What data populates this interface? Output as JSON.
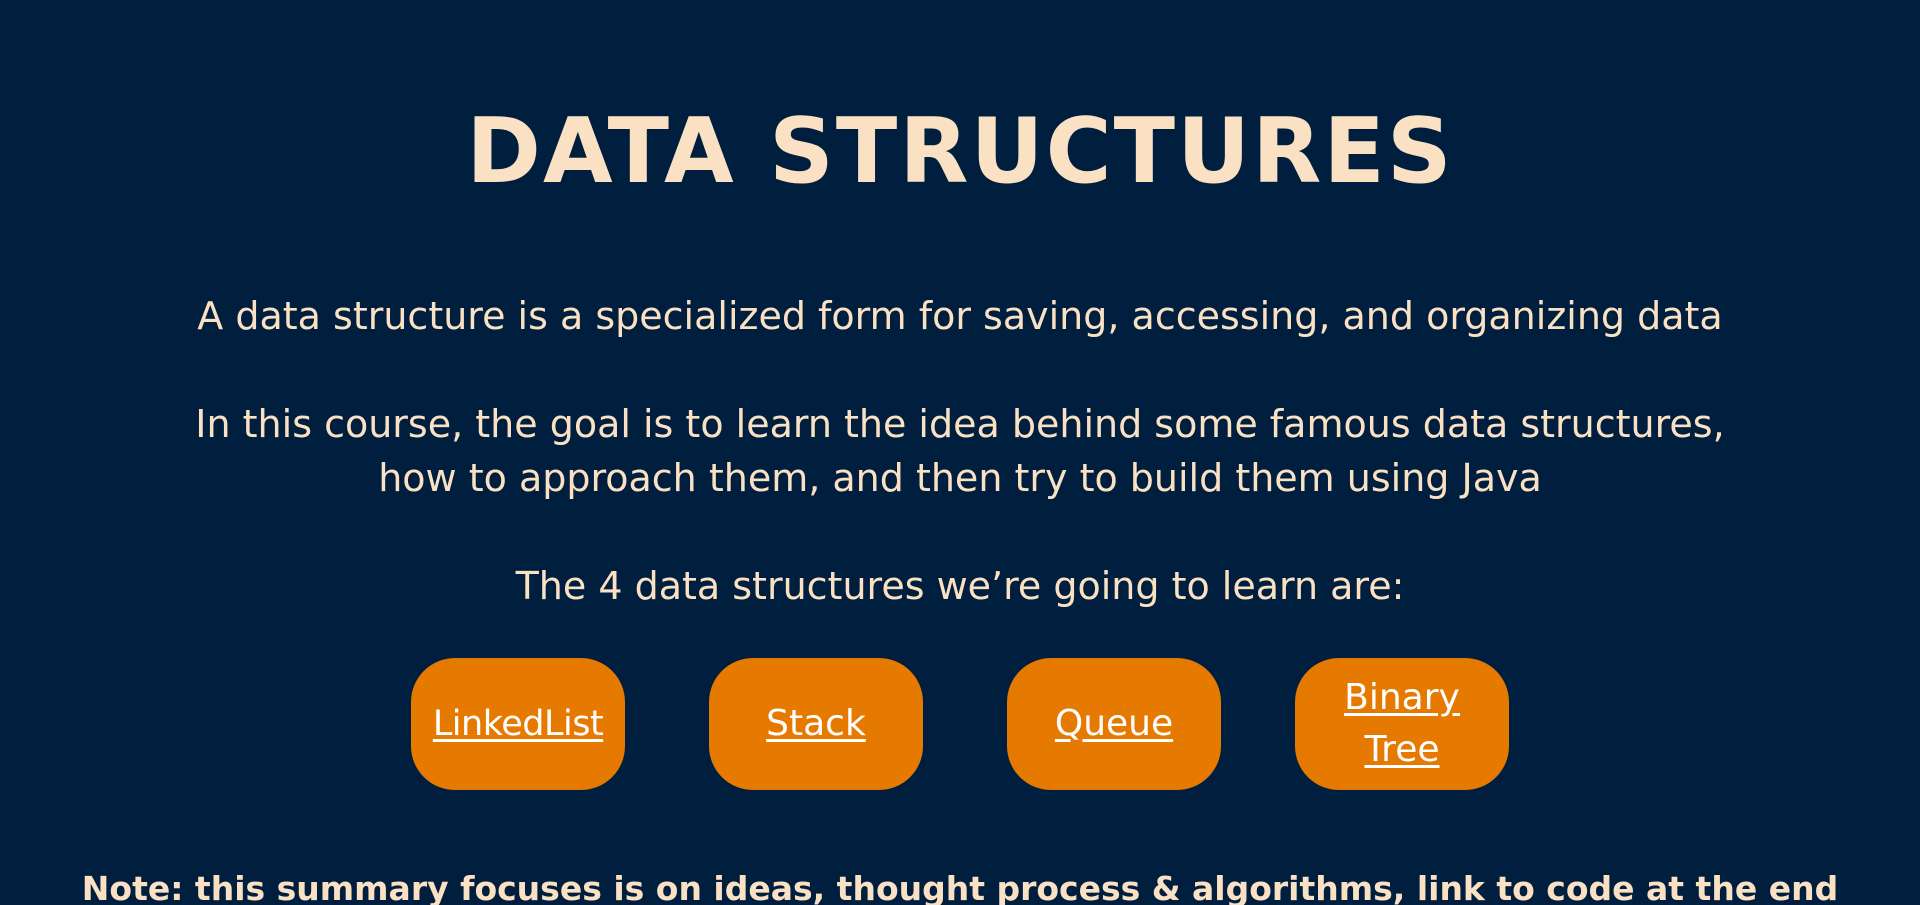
{
  "page": {
    "title": "DATA STRUCTURES",
    "intro": "A data structure is a specialized form for saving, accessing, and organizing data",
    "goal_line1": "In this course, the goal is to learn the idea behind some famous data structures,",
    "goal_line2": "how to approach them, and then try to build them using Java",
    "list_heading": "The 4 data structures we’re going to learn are:",
    "note": "Note: this summary focuses is on ideas, thought process & algorithms, link to code at the end"
  },
  "buttons": {
    "linkedlist": "LinkedList",
    "stack": "Stack",
    "queue": "Queue",
    "binary_tree_line1": "Binary",
    "binary_tree_line2": "Tree"
  },
  "colors": {
    "background": "#001f3f",
    "text": "#fae1c4",
    "button": "#e67a00",
    "button_text": "#ffffff"
  }
}
